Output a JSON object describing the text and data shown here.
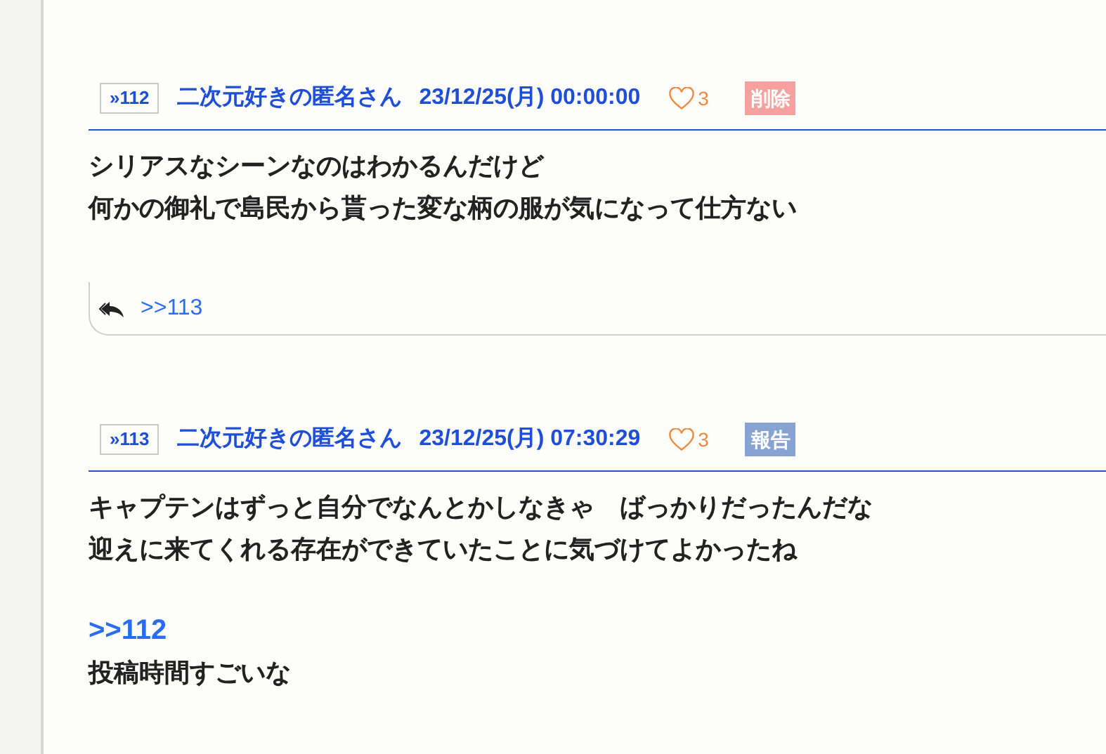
{
  "posts": [
    {
      "number": "»112",
      "author": "二次元好きの匿名さん",
      "date": "23/12/25(月) 00:00:00",
      "likes": "3",
      "action": {
        "kind": "delete",
        "label": "削除"
      },
      "body": [
        {
          "kind": "text",
          "lines": [
            "シリアスなシーンなのはわかるんだけど",
            "何かの御礼で島民から貰った変な柄の服が気になって仕方ない"
          ]
        }
      ],
      "replies": [
        ">>113"
      ]
    },
    {
      "number": "»113",
      "author": "二次元好きの匿名さん",
      "date": "23/12/25(月) 07:30:29",
      "likes": "3",
      "action": {
        "kind": "report",
        "label": "報告"
      },
      "body": [
        {
          "kind": "text",
          "lines": [
            "キャプテンはずっと自分でなんとかしなきゃ　ばっかりだったんだな",
            "迎えに来てくれる存在ができていたことに気づけてよかったね"
          ]
        },
        {
          "kind": "anchor",
          "text": ">>112"
        },
        {
          "kind": "text",
          "lines": [
            "投稿時間すごいな"
          ]
        }
      ]
    }
  ]
}
